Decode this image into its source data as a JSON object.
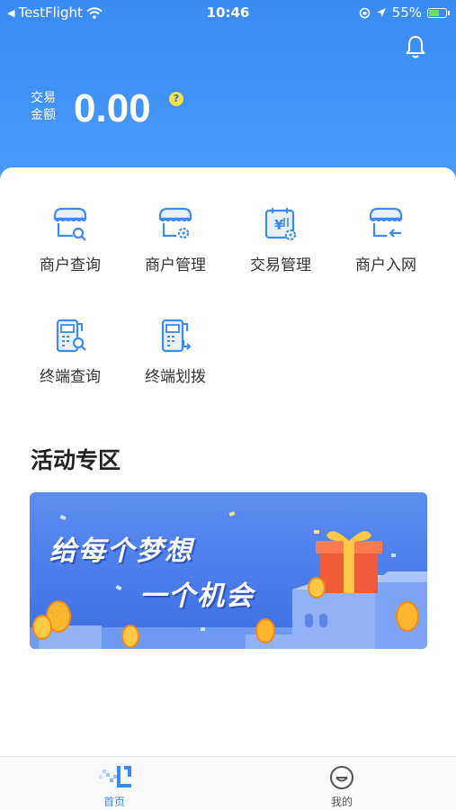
{
  "status_bar": {
    "back_app": "TestFlight",
    "time": "10:46",
    "battery": "55%"
  },
  "hero": {
    "amount_label": "交易金额",
    "amount_value": "0.00",
    "help_badge": "?"
  },
  "menu": [
    {
      "label": "商户查询",
      "icon": "merchant-search-icon"
    },
    {
      "label": "商户管理",
      "icon": "merchant-manage-icon"
    },
    {
      "label": "交易管理",
      "icon": "transaction-manage-icon"
    },
    {
      "label": "商户入网",
      "icon": "merchant-onboard-icon"
    },
    {
      "label": "终端查询",
      "icon": "terminal-search-icon"
    },
    {
      "label": "终端划拨",
      "icon": "terminal-transfer-icon"
    }
  ],
  "activity": {
    "title": "活动专区",
    "banner_line1": "给每个梦想",
    "banner_line2": "一个机会"
  },
  "tabbar": {
    "tabs": [
      {
        "label": "首页",
        "active": true
      },
      {
        "label": "我的",
        "active": false
      }
    ]
  },
  "colors": {
    "brand_blue": "#3a8bf4",
    "accent_yellow": "#f5e14b",
    "tab_active": "#3a8bf4",
    "tab_inactive": "#555555"
  }
}
